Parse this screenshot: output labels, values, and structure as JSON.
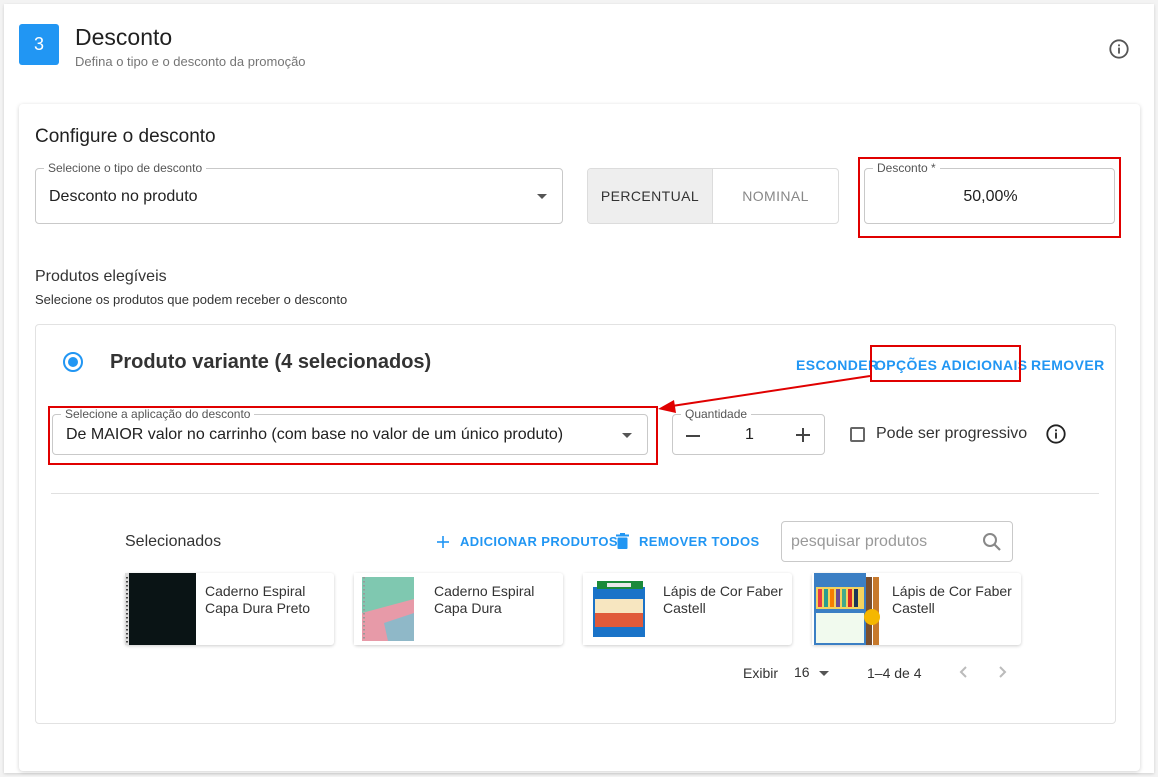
{
  "header": {
    "step": "3",
    "title": "Desconto",
    "subtitle": "Defina o tipo e o desconto da promoção"
  },
  "configure": {
    "title": "Configure o desconto",
    "discount_type": {
      "label": "Selecione o tipo de desconto",
      "value": "Desconto no produto"
    },
    "toggle": {
      "percentual": "PERCENTUAL",
      "nominal": "NOMINAL",
      "selected": "PERCENTUAL"
    },
    "discount": {
      "label": "Desconto *",
      "value": "50,00%"
    }
  },
  "eligible": {
    "title": "Produtos elegíveis",
    "subtitle": "Selecione os produtos que podem receber o desconto"
  },
  "variant": {
    "title": "Produto variante (4 selecionados)",
    "hide_link": "ESCONDER",
    "options_link": "OPÇÕES ADICIONAIS",
    "remove_link": "REMOVER",
    "application": {
      "label": "Selecione a aplicação do desconto",
      "value": "De MAIOR valor no carrinho (com base no valor de um único produto)"
    },
    "quantity": {
      "label": "Quantidade",
      "value": "1"
    },
    "progressive_label": "Pode ser progressivo",
    "progressive_checked": false
  },
  "selected": {
    "label": "Selecionados",
    "add_products": "ADICIONAR PRODUTOS",
    "remove_all": "REMOVER TODOS",
    "search_placeholder": "pesquisar produtos",
    "products": [
      {
        "name": "Caderno Espiral Capa Dura Preto"
      },
      {
        "name": "Caderno Espiral Capa Dura"
      },
      {
        "name": "Lápis de Cor Faber Castell"
      },
      {
        "name": "Lápis de Cor Faber Castell"
      }
    ],
    "pagination": {
      "show_label": "Exibir",
      "per_page": "16",
      "range": "1–4 de 4"
    }
  },
  "colors": {
    "accent": "#2196f3",
    "highlight": "#e00000"
  }
}
